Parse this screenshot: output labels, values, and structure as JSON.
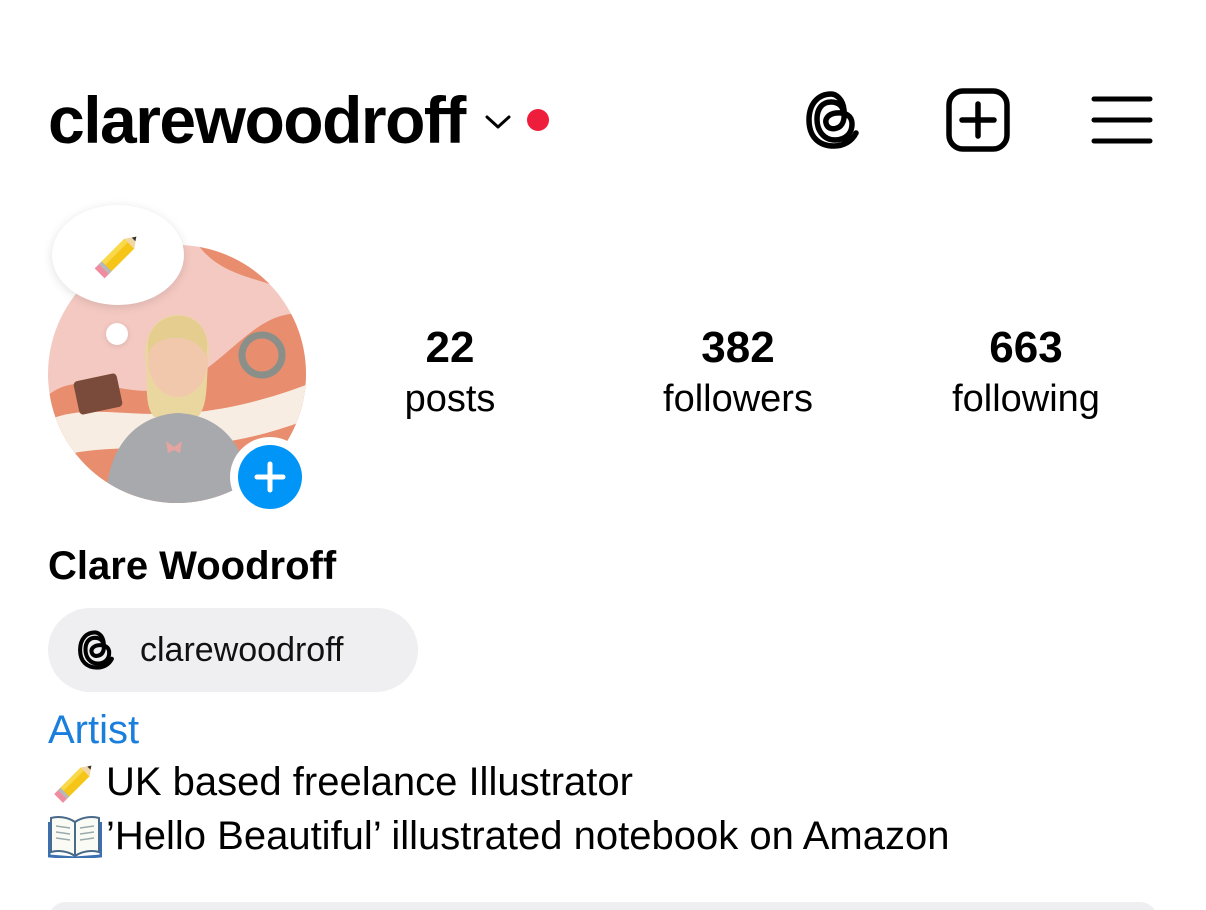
{
  "header": {
    "username": "clarewoodroff",
    "notification_dot_color": "#ee1d3c",
    "icons": [
      "threads-icon",
      "create-post-icon",
      "menu-icon"
    ]
  },
  "profile": {
    "note_emoji": "✏️",
    "display_name": "Clare Woodroff",
    "threads_handle": "clarewoodroff",
    "category": "Artist",
    "category_color": "#1a7fdc",
    "add_story_color": "#0095f6",
    "bio": [
      {
        "emoji": "pencil",
        "text": "UK based freelance Illustrator"
      },
      {
        "emoji": "open-book",
        "text": "’Hello Beautiful’ illustrated notebook on Amazon"
      }
    ]
  },
  "stats": {
    "posts": {
      "value": "22",
      "label": "posts"
    },
    "followers": {
      "value": "382",
      "label": "followers"
    },
    "following": {
      "value": "663",
      "label": "following"
    }
  }
}
